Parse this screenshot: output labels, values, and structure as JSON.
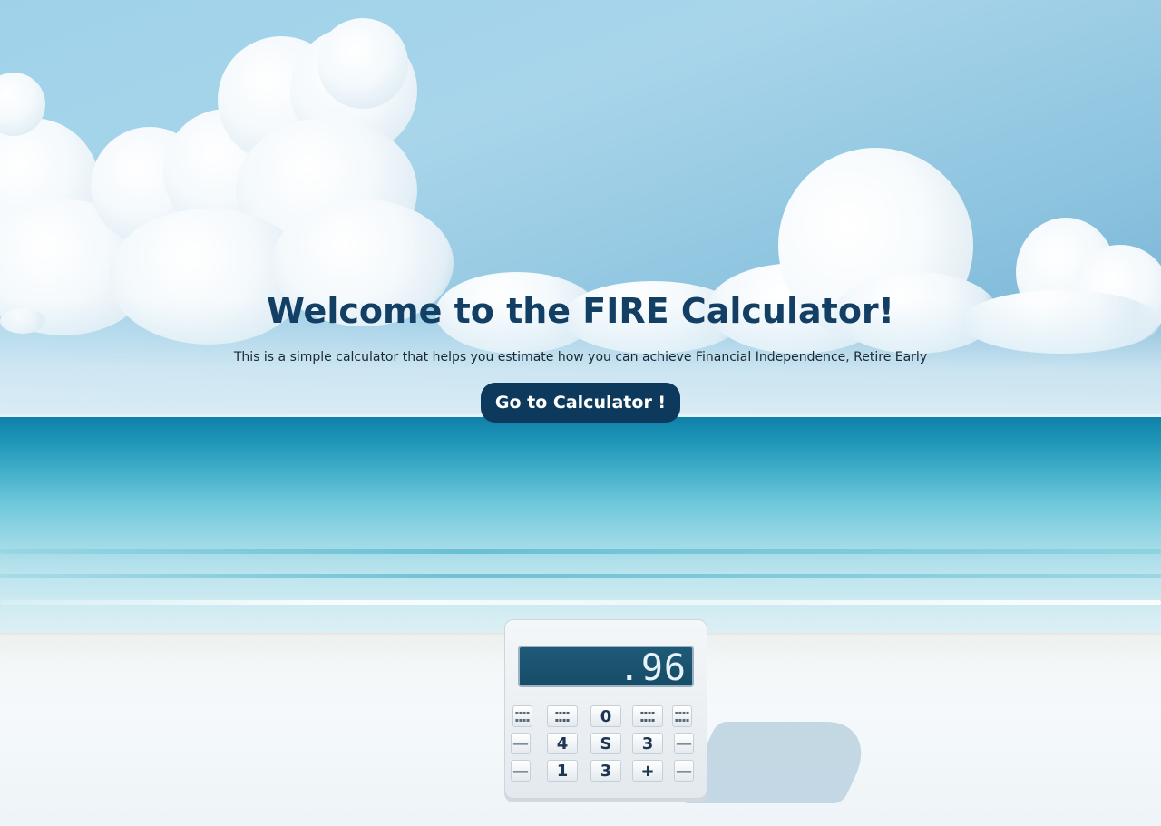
{
  "hero": {
    "title": "Welcome to the FIRE Calculator!",
    "subtitle": "This is a simple calculator that helps you estimate how you can achieve Financial Independence, Retire Early",
    "cta_label": "Go to Calculator !"
  },
  "illustration": {
    "display_value": ".96",
    "keys_row1": [
      "",
      "",
      "0",
      "",
      ""
    ],
    "keys_row2": [
      "—",
      "4",
      "S",
      "3",
      "—"
    ],
    "keys_row3": [
      "—",
      "1",
      "3",
      "+",
      "—"
    ]
  },
  "colors": {
    "title": "#123f63",
    "button_bg": "#0d3a5c",
    "button_text": "#ffffff",
    "subtitle": "#1c2733"
  }
}
